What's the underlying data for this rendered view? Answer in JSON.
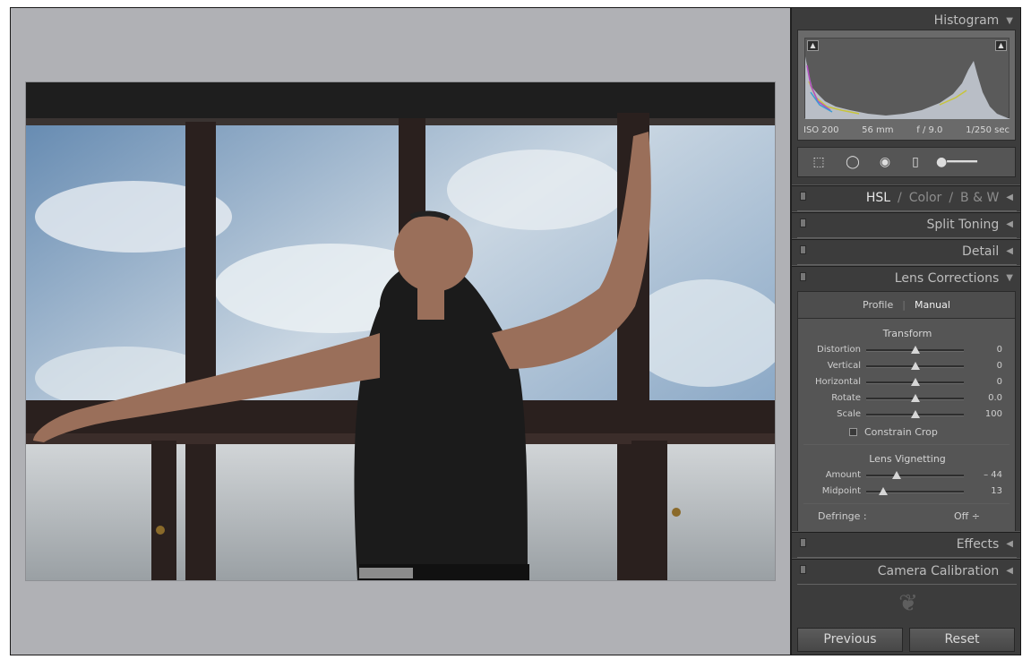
{
  "panels": {
    "histogram": {
      "title": "Histogram",
      "exif": {
        "iso": "ISO 200",
        "focal": "56 mm",
        "aperture": "f / 9.0",
        "shutter": "1/250 sec"
      }
    },
    "hsl": {
      "hsl": "HSL",
      "sep1": "/",
      "color": "Color",
      "sep2": "/",
      "bw": "B & W"
    },
    "split_toning": {
      "title": "Split Toning"
    },
    "detail": {
      "title": "Detail"
    },
    "lens_corrections": {
      "title": "Lens Corrections",
      "tabs": {
        "profile": "Profile",
        "sep": "|",
        "manual": "Manual"
      },
      "transform": {
        "title": "Transform",
        "sliders": [
          {
            "label": "Distortion",
            "value": "0",
            "pos": 0.5
          },
          {
            "label": "Vertical",
            "value": "0",
            "pos": 0.5
          },
          {
            "label": "Horizontal",
            "value": "0",
            "pos": 0.5
          },
          {
            "label": "Rotate",
            "value": "0.0",
            "pos": 0.5
          },
          {
            "label": "Scale",
            "value": "100",
            "pos": 0.5
          }
        ],
        "constrain_crop": "Constrain Crop"
      },
      "vignetting": {
        "title": "Lens Vignetting",
        "sliders": [
          {
            "label": "Amount",
            "value": "– 44",
            "pos": 0.31
          },
          {
            "label": "Midpoint",
            "value": "13",
            "pos": 0.17
          }
        ]
      },
      "defringe": {
        "label": "Defringe :",
        "value": "Off ÷"
      }
    },
    "effects": {
      "title": "Effects"
    },
    "camera_calibration": {
      "title": "Camera Calibration"
    }
  },
  "buttons": {
    "previous": "Previous",
    "reset": "Reset"
  },
  "colors": {
    "panel": "#3c3c3c",
    "canvas": "#b0b1b5"
  }
}
